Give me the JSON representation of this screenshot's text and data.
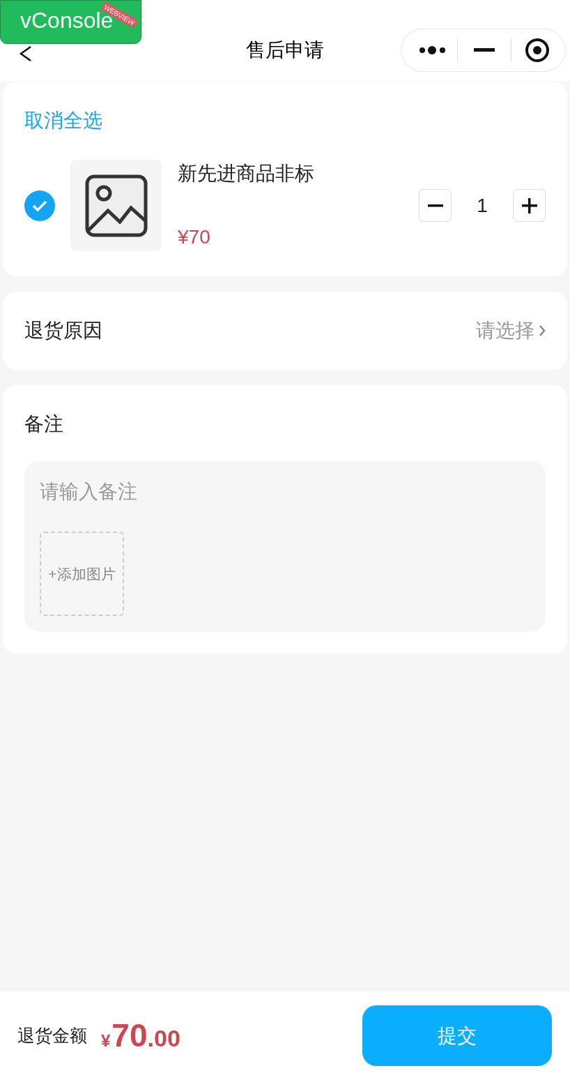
{
  "debug_button": {
    "label": "vConsole",
    "ribbon": "WEBVIEW"
  },
  "nav": {
    "title": "售后申请"
  },
  "goods": {
    "select_all_label": "取消全选",
    "items": [
      {
        "name": "新先进商品非标",
        "price": "¥70",
        "checked": true,
        "quantity": "1"
      }
    ]
  },
  "reason": {
    "label": "退货原因",
    "placeholder": "请选择"
  },
  "remark": {
    "label": "备注",
    "placeholder": "请输入备注",
    "add_image": "+添加图片"
  },
  "footer": {
    "amount_label": "退货金额",
    "currency": "¥",
    "amount_integer": "70",
    "amount_decimal": ".00",
    "submit": "提交"
  }
}
